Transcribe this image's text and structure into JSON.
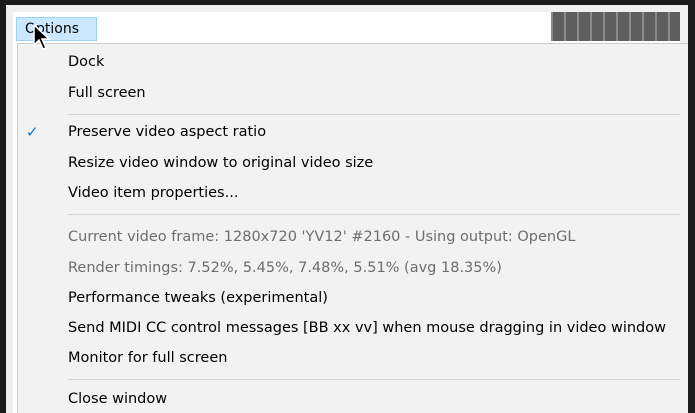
{
  "menubar": {
    "title": "Options"
  },
  "menu": {
    "items": [
      {
        "label": "Dock",
        "enabled": true,
        "checked": false
      },
      {
        "label": "Full screen",
        "enabled": true,
        "checked": false
      },
      {
        "label": "Preserve video aspect ratio",
        "enabled": true,
        "checked": true
      },
      {
        "label": "Resize video window to original video size",
        "enabled": true,
        "checked": false
      },
      {
        "label": "Video item properties...",
        "enabled": true,
        "checked": false
      },
      {
        "label": "Current video frame: 1280x720 'YV12' #2160 - Using output: OpenGL",
        "enabled": false,
        "checked": false
      },
      {
        "label": "Render timings: 7.52%, 5.45%, 7.48%, 5.51% (avg 18.35%)",
        "enabled": false,
        "checked": false
      },
      {
        "label": "Performance tweaks (experimental)",
        "enabled": true,
        "checked": false
      },
      {
        "label": "Send MIDI CC control messages [BB xx vv] when mouse dragging in video window",
        "enabled": true,
        "checked": false
      },
      {
        "label": "Monitor for full screen",
        "enabled": true,
        "checked": false
      },
      {
        "label": "Close window",
        "enabled": true,
        "checked": false
      }
    ],
    "check_glyph": "✓"
  },
  "icons": {
    "check": "checkmark-icon",
    "cursor": "mouse-pointer-icon"
  },
  "colors": {
    "menu_background": "#f2f2f2",
    "highlight": "#cce8ff",
    "check": "#0078d7",
    "disabled_text": "#6d6d6d"
  }
}
